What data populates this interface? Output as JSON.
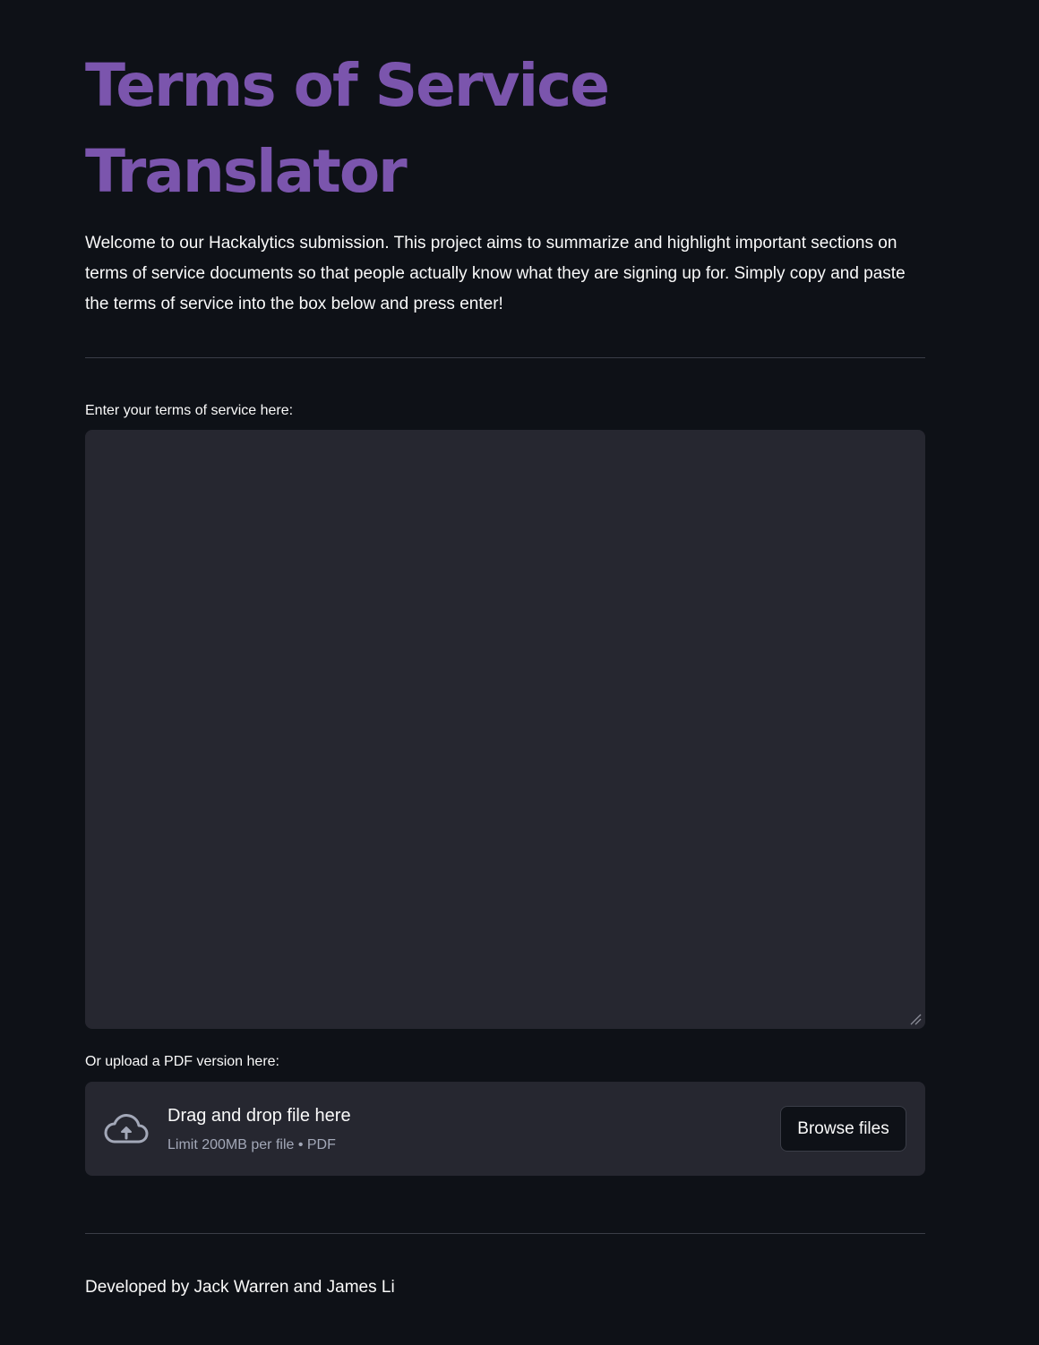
{
  "page": {
    "title": "Terms of Service Translator",
    "intro": "Welcome to our Hackalytics submission. This project aims to summarize and highlight important sections on terms of service documents so that people actually know what they are signing up for. Simply copy and paste the terms of service into the box below and press enter!"
  },
  "tos_input": {
    "label": "Enter your terms of service here:",
    "value": "",
    "placeholder": ""
  },
  "pdf_upload": {
    "label": "Or upload a PDF version here:",
    "drop_text": "Drag and drop file here",
    "limit_text": "Limit 200MB per file • PDF",
    "browse_label": "Browse files",
    "icon": "cloud-upload-icon"
  },
  "footer": {
    "credit": "Developed by Jack Warren and James Li"
  },
  "colors": {
    "background": "#0e1117",
    "title": "#7b55ad",
    "surface": "#262730",
    "text": "#fafafa",
    "muted": "#a3a8b8"
  }
}
